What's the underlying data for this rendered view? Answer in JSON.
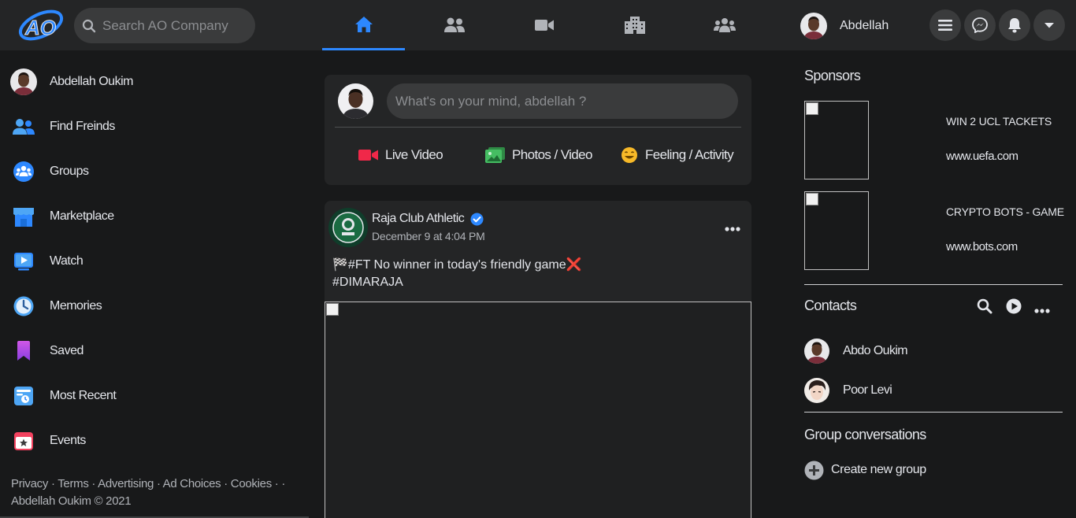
{
  "topbar": {
    "search_placeholder": "Search AO Company",
    "logo_text": "AO",
    "nav_tabs": [
      {
        "name": "home",
        "active": true
      },
      {
        "name": "friends",
        "active": false
      },
      {
        "name": "watch",
        "active": false
      },
      {
        "name": "marketplace",
        "active": false
      },
      {
        "name": "groups",
        "active": false
      }
    ],
    "profile_name": "Abdellah",
    "accent_color": "#2d88ff"
  },
  "sidebar": {
    "items": [
      {
        "label": "Abdellah Oukim",
        "icon": "avatar"
      },
      {
        "label": "Find Freinds",
        "icon": "friends-icon"
      },
      {
        "label": "Groups",
        "icon": "groups-icon"
      },
      {
        "label": "Marketplace",
        "icon": "marketplace-icon"
      },
      {
        "label": "Watch",
        "icon": "watch-icon"
      },
      {
        "label": "Memories",
        "icon": "memories-icon"
      },
      {
        "label": "Saved",
        "icon": "saved-icon"
      },
      {
        "label": "Most Recent",
        "icon": "most-recent-icon"
      },
      {
        "label": "Events",
        "icon": "events-icon"
      }
    ],
    "footer_links": "Privacy · Terms · Advertising · Ad Choices · Cookies · ·",
    "footer_copyright": "Abdellah Oukim © 2021"
  },
  "composer": {
    "placeholder": "What's on your mind, abdellah ?",
    "actions": [
      {
        "label": "Live Video",
        "icon": "live-video-icon",
        "color": "#f02849"
      },
      {
        "label": "Photos / Video",
        "icon": "photos-icon",
        "color": "#45bd62"
      },
      {
        "label": "Feeling / Activity",
        "icon": "feeling-icon",
        "color": "#f7b928"
      }
    ]
  },
  "post": {
    "author": "Raja Club Athletic",
    "verified": true,
    "date": "December 9 at 4:04 PM",
    "text_line1": "🏁#FT No winner in today's friendly game❌",
    "text_line2": "#DIMARAJA"
  },
  "sponsors": {
    "heading": "Sponsors",
    "items": [
      {
        "title": "WIN 2 UCL TACKETS",
        "url": "www.uefa.com"
      },
      {
        "title": "CRYPTO BOTS - GAME",
        "url": "www.bots.com"
      }
    ]
  },
  "contacts": {
    "heading": "Contacts",
    "items": [
      {
        "name": "Abdo Oukim"
      },
      {
        "name": "Poor Levi"
      }
    ]
  },
  "group_conversations": {
    "heading": "Group conversations",
    "create_label": "Create new group"
  }
}
